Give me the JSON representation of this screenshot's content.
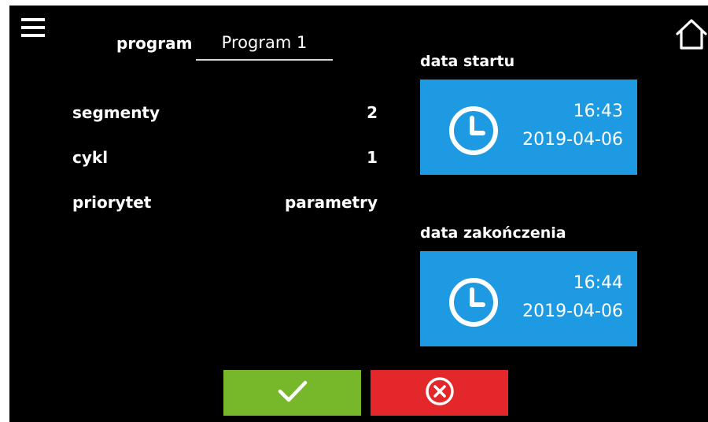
{
  "header": {
    "menu_icon": "hamburger-menu-icon",
    "home_icon": "home-icon"
  },
  "program": {
    "label": "program",
    "value": "Program 1"
  },
  "params": [
    {
      "label": "segmenty",
      "value": "2"
    },
    {
      "label": "cykl",
      "value": "1"
    },
    {
      "label": "priorytet",
      "value": "parametry"
    }
  ],
  "start": {
    "heading": "data startu",
    "time": "16:43",
    "date": "2019-04-06",
    "icon": "clock-icon"
  },
  "end": {
    "heading": "data zakończenia",
    "time": "16:44",
    "date": "2019-04-06",
    "icon": "clock-icon"
  },
  "actions": {
    "confirm_icon": "checkmark-icon",
    "cancel_icon": "cancel-x-circle-icon"
  },
  "colors": {
    "background": "#000000",
    "tile": "#1d9ae2",
    "confirm": "#76b82a",
    "cancel": "#e3272b"
  }
}
